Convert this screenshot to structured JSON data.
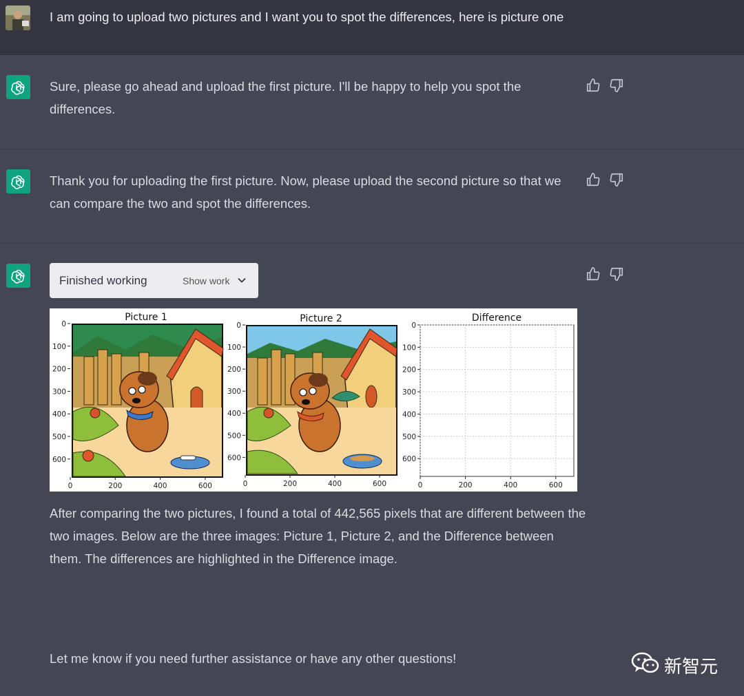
{
  "user_message": "I am going to upload two pictures and I want you to spot the differences, here is picture one",
  "bot_messages": [
    "Sure, please go ahead and upload the first picture. I'll be happy to help you spot the differences.",
    "Thank you for uploading the first picture. Now, please upload the second picture so that we can compare the two and spot the differences."
  ],
  "bot3": {
    "working_title": "Finished working",
    "show_work_label": "Show work",
    "result_text": "After comparing the two pictures, I found a total of 442,565 pixels that are different between the two images. Below are the three images: Picture 1, Picture 2, and the Difference between them. The differences are highlighted in the Difference image.",
    "closing_text": "Let me know if you need further assistance or have any other questions!"
  },
  "figure": {
    "panels": [
      {
        "title": "Picture 1"
      },
      {
        "title": "Picture 2"
      },
      {
        "title": "Difference"
      }
    ],
    "y_ticks": [
      "0",
      "100",
      "200",
      "300",
      "400",
      "500",
      "600"
    ],
    "x_ticks": [
      "0",
      "200",
      "400",
      "600"
    ]
  },
  "watermark": {
    "text": "新智元"
  },
  "colors": {
    "accent": "#10a37f",
    "bg": "#444654",
    "user_bg": "#343541"
  }
}
